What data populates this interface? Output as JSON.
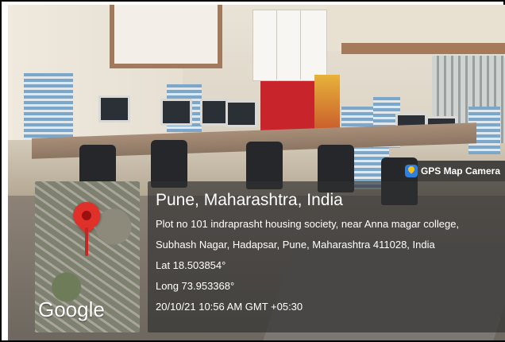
{
  "overlay": {
    "camera_badge": "GPS Map Camera",
    "location_title": "Pune, Maharashtra, India",
    "address_line1": "Plot no 101 indraprasht housing society, near Anna magar college,",
    "address_line2": "Subhash Nagar, Hadapsar, Pune, Maharashtra 411028, India",
    "latitude": "Lat 18.503854°",
    "longitude": "Long 73.953368°",
    "timestamp": "20/10/21 10:56 AM GMT +05:30",
    "map_logo": "Google"
  },
  "icons": {
    "camera_badge_icon": "gps-map-camera-icon",
    "map_pin": "location-pin-icon"
  },
  "colors": {
    "pin": "#e0302a",
    "overlay_bg": "#303030",
    "text": "#ffffff"
  }
}
